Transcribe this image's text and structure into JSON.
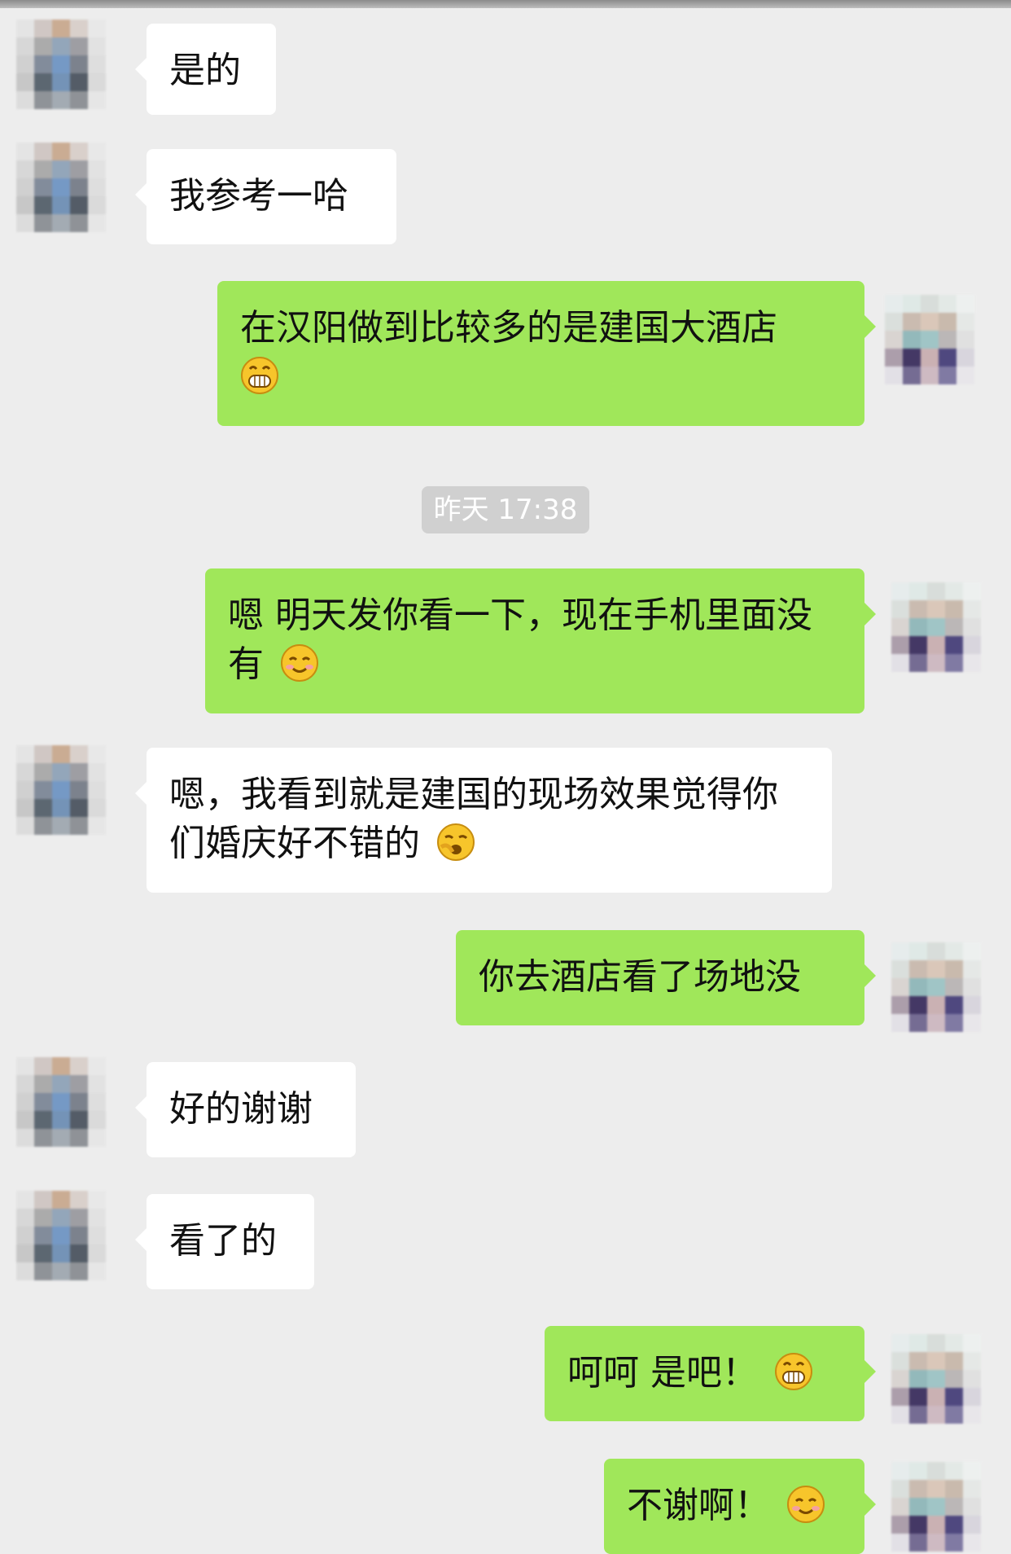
{
  "timestamp": "昨天 17:38",
  "messages": [
    {
      "side": "in",
      "text": "是的",
      "emoji": null
    },
    {
      "side": "in",
      "text": "我参考一哈",
      "emoji": null
    },
    {
      "side": "out",
      "text": "在汉阳做到比较多的是建国大酒店",
      "emoji": "grin"
    },
    {
      "side": "out",
      "text": "嗯 明天发你看一下，现在手机里面没有",
      "emoji": "smile"
    },
    {
      "side": "in",
      "text": "嗯，我看到就是建国的现场效果觉得你们婚庆好不错的",
      "emoji": "yawn"
    },
    {
      "side": "out",
      "text": "你去酒店看了场地没",
      "emoji": null
    },
    {
      "side": "in",
      "text": "好的谢谢",
      "emoji": null
    },
    {
      "side": "in",
      "text": "看了的",
      "emoji": null
    },
    {
      "side": "out",
      "text": "呵呵  是吧！",
      "emoji": "grin"
    },
    {
      "side": "out",
      "text": "不谢啊！",
      "emoji": "smile"
    }
  ],
  "colors": {
    "background": "#ededed",
    "outgoing_bubble": "#a0e75a",
    "incoming_bubble": "#ffffff",
    "timestamp_pill": "#d0d0d0"
  }
}
